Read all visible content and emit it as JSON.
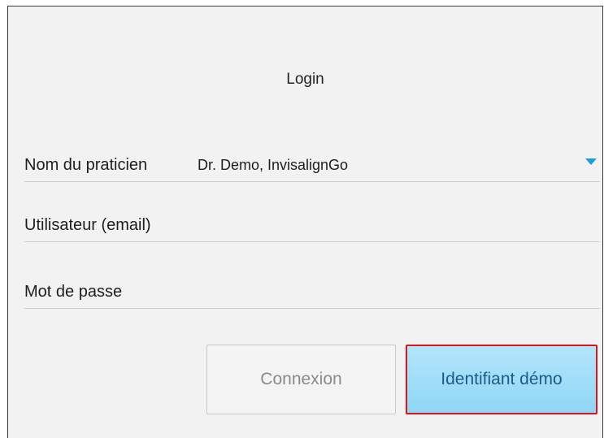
{
  "login": {
    "title": "Login",
    "fields": {
      "practitioner": {
        "label": "Nom du praticien",
        "value": "Dr. Demo, InvisalignGo"
      },
      "username": {
        "label": "Utilisateur (email)"
      },
      "password": {
        "label": "Mot de passe"
      }
    },
    "buttons": {
      "connexion": "Connexion",
      "demo": "Identifiant démo"
    }
  },
  "colors": {
    "accent": "#1a9ce0",
    "demo_button": "#a5e0f9",
    "highlight_border": "#e0131b"
  },
  "icons": {
    "dropdown": "chevron-down-icon"
  }
}
